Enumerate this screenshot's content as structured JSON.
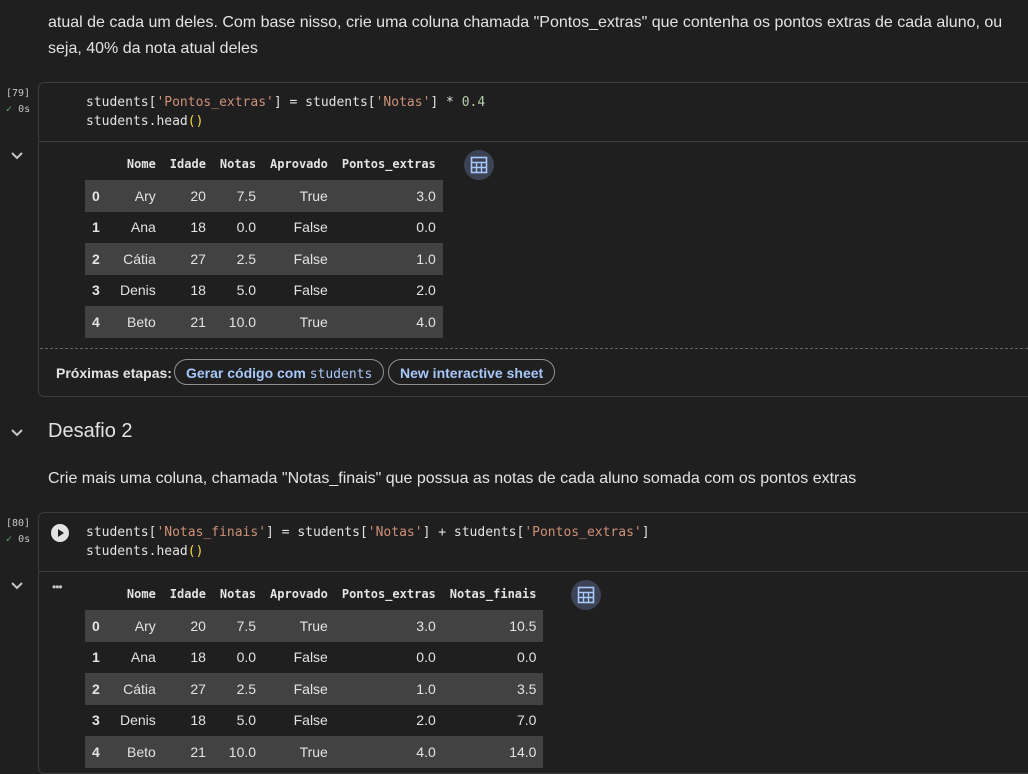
{
  "markdown_top": "atual de cada um deles. Com base nisso, crie uma coluna chamada \"Pontos_extras\" que contenha os pontos extras de cada aluno, ou seja, 40% da nota atual deles",
  "cell1": {
    "exec_count": "[79]",
    "exec_time": "0s",
    "code_line1": [
      "students[",
      "'Pontos_extras'",
      "] = students[",
      "'Notas'",
      "] * ",
      "0.4"
    ],
    "code_line2": [
      "students.head",
      "()"
    ],
    "table": {
      "headers": [
        "",
        "Nome",
        "Idade",
        "Notas",
        "Aprovado",
        "Pontos_extras"
      ],
      "rows": [
        [
          "0",
          "Ary",
          "20",
          "7.5",
          "True",
          "3.0"
        ],
        [
          "1",
          "Ana",
          "18",
          "0.0",
          "False",
          "0.0"
        ],
        [
          "2",
          "Cátia",
          "27",
          "2.5",
          "False",
          "1.0"
        ],
        [
          "3",
          "Denis",
          "18",
          "5.0",
          "False",
          "2.0"
        ],
        [
          "4",
          "Beto",
          "21",
          "10.0",
          "True",
          "4.0"
        ]
      ]
    },
    "next_steps_label": "Próximas etapas:",
    "chip1_text": "Gerar código com",
    "chip1_code": "students",
    "chip2_text": "New interactive sheet"
  },
  "section_title": "Desafio 2",
  "markdown_desafio": "Crie mais uma coluna, chamada \"Notas_finais\" que possua as notas de cada aluno somada com os pontos extras",
  "cell2": {
    "exec_count": "[80]",
    "exec_time": "0s",
    "code_line1": [
      "students[",
      "'Notas_finais'",
      "] = students[",
      "'Notas'",
      "] + students[",
      "'Pontos_extras'",
      "]"
    ],
    "code_line2": [
      "students.head",
      "()"
    ],
    "table": {
      "headers": [
        "",
        "Nome",
        "Idade",
        "Notas",
        "Aprovado",
        "Pontos_extras",
        "Notas_finais"
      ],
      "rows": [
        [
          "0",
          "Ary",
          "20",
          "7.5",
          "True",
          "3.0",
          "10.5"
        ],
        [
          "1",
          "Ana",
          "18",
          "0.0",
          "False",
          "0.0",
          "0.0"
        ],
        [
          "2",
          "Cátia",
          "27",
          "2.5",
          "False",
          "1.0",
          "3.5"
        ],
        [
          "3",
          "Denis",
          "18",
          "5.0",
          "False",
          "2.0",
          "7.0"
        ],
        [
          "4",
          "Beto",
          "21",
          "10.0",
          "True",
          "4.0",
          "14.0"
        ]
      ]
    },
    "output_menu": "•••"
  }
}
